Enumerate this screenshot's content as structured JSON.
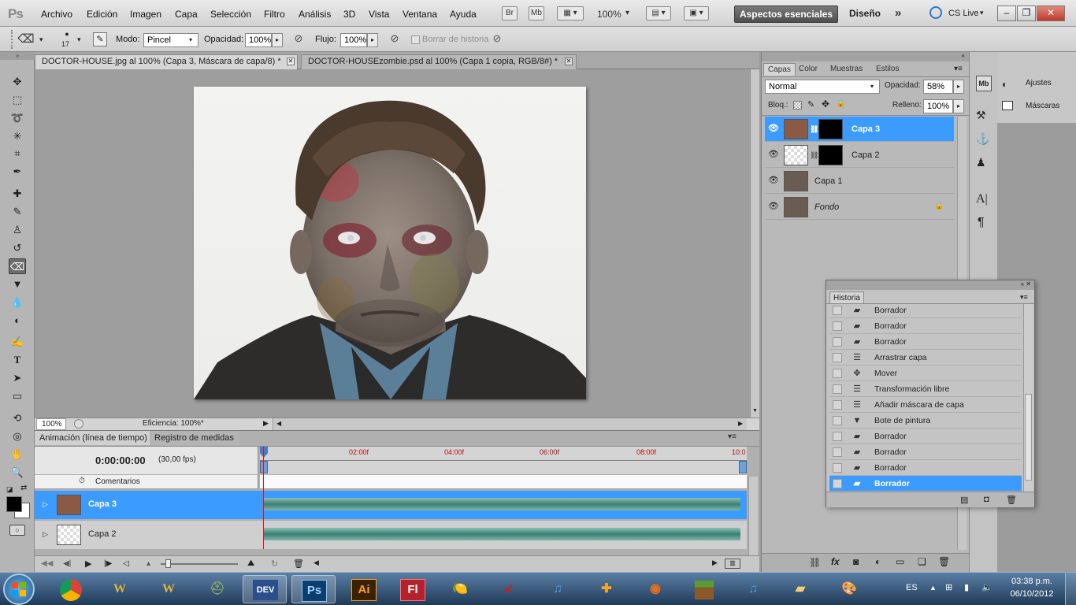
{
  "app": {
    "logo": "Ps"
  },
  "menu": [
    "Archivo",
    "Edición",
    "Imagen",
    "Capa",
    "Selección",
    "Filtro",
    "Análisis",
    "3D",
    "Vista",
    "Ventana",
    "Ayuda"
  ],
  "menubar": {
    "bridge_btn": "Br",
    "minibridge_btn": "Mb",
    "zoom": "100%",
    "workspace_active": "Aspectos esenciales",
    "workspace_other": "Diseño",
    "more": "»",
    "cslive": "CS Live"
  },
  "options": {
    "brush_size": "17",
    "mode_label": "Modo:",
    "mode_value": "Pincel",
    "opacity_label": "Opacidad:",
    "opacity_value": "100%",
    "flow_label": "Flujo:",
    "flow_value": "100%",
    "erase_history_label": "Borrar de historia"
  },
  "doc_tabs": [
    {
      "label": "DOCTOR-HOUSE.jpg al 100% (Capa 3, Máscara de capa/8) *",
      "active": true
    },
    {
      "label": "DOCTOR-HOUSEzombie.psd al 100% (Capa 1 copia, RGB/8#) *",
      "active": false
    }
  ],
  "status": {
    "zoom": "100%",
    "efficiency": "Eficiencia: 100%*"
  },
  "timeline": {
    "tab_active": "Animación (línea de tiempo)",
    "tab_other": "Registro de medidas",
    "time": "0:00:00:00",
    "fps": "(30,00 fps)",
    "ruler": [
      "02:00f",
      "04:00f",
      "06:00f",
      "08:00f",
      "10:0"
    ],
    "comments": "Comentarios",
    "layers": [
      {
        "name": "Capa 3",
        "selected": true
      },
      {
        "name": "Capa 2",
        "selected": false
      }
    ]
  },
  "layers_panel": {
    "tabs": [
      "Capas",
      "Color",
      "Muestras",
      "Estilos"
    ],
    "blend_mode": "Normal",
    "opacity_label": "Opacidad:",
    "opacity_value": "58%",
    "lock_label": "Bloq.:",
    "fill_label": "Relleno:",
    "fill_value": "100%",
    "layers": [
      {
        "name": "Capa 3",
        "selected": true,
        "mask": true
      },
      {
        "name": "Capa 2",
        "selected": false,
        "mask": true
      },
      {
        "name": "Capa 1",
        "selected": false,
        "mask": false
      },
      {
        "name": "Fondo",
        "selected": false,
        "mask": false,
        "locked": true
      }
    ]
  },
  "adjust_panel": {
    "ajustes": "Ajustes",
    "mascaras": "Máscaras"
  },
  "history": {
    "title": "Historia",
    "items": [
      {
        "label": "Borrador",
        "icon": "eraser-icon"
      },
      {
        "label": "Borrador",
        "icon": "eraser-icon"
      },
      {
        "label": "Borrador",
        "icon": "eraser-icon"
      },
      {
        "label": "Arrastrar capa",
        "icon": "document-icon"
      },
      {
        "label": "Mover",
        "icon": "move-icon"
      },
      {
        "label": "Transformación libre",
        "icon": "document-icon"
      },
      {
        "label": "Añadir máscara de capa",
        "icon": "document-icon"
      },
      {
        "label": "Bote de pintura",
        "icon": "paint-bucket-icon"
      },
      {
        "label": "Borrador",
        "icon": "eraser-icon"
      },
      {
        "label": "Borrador",
        "icon": "eraser-icon"
      },
      {
        "label": "Borrador",
        "icon": "eraser-icon"
      },
      {
        "label": "Borrador",
        "icon": "eraser-icon",
        "selected": true
      }
    ]
  },
  "taskbar": {
    "apps": [
      "DEV",
      "Ps",
      "Ai",
      "Fl"
    ],
    "lang": "ES",
    "time": "03:38 p.m.",
    "date": "06/10/2012"
  },
  "colors": {
    "selection_blue": "#3c9bff",
    "accent_red": "#c8102e",
    "ps_blue": "#0b3e6f"
  }
}
